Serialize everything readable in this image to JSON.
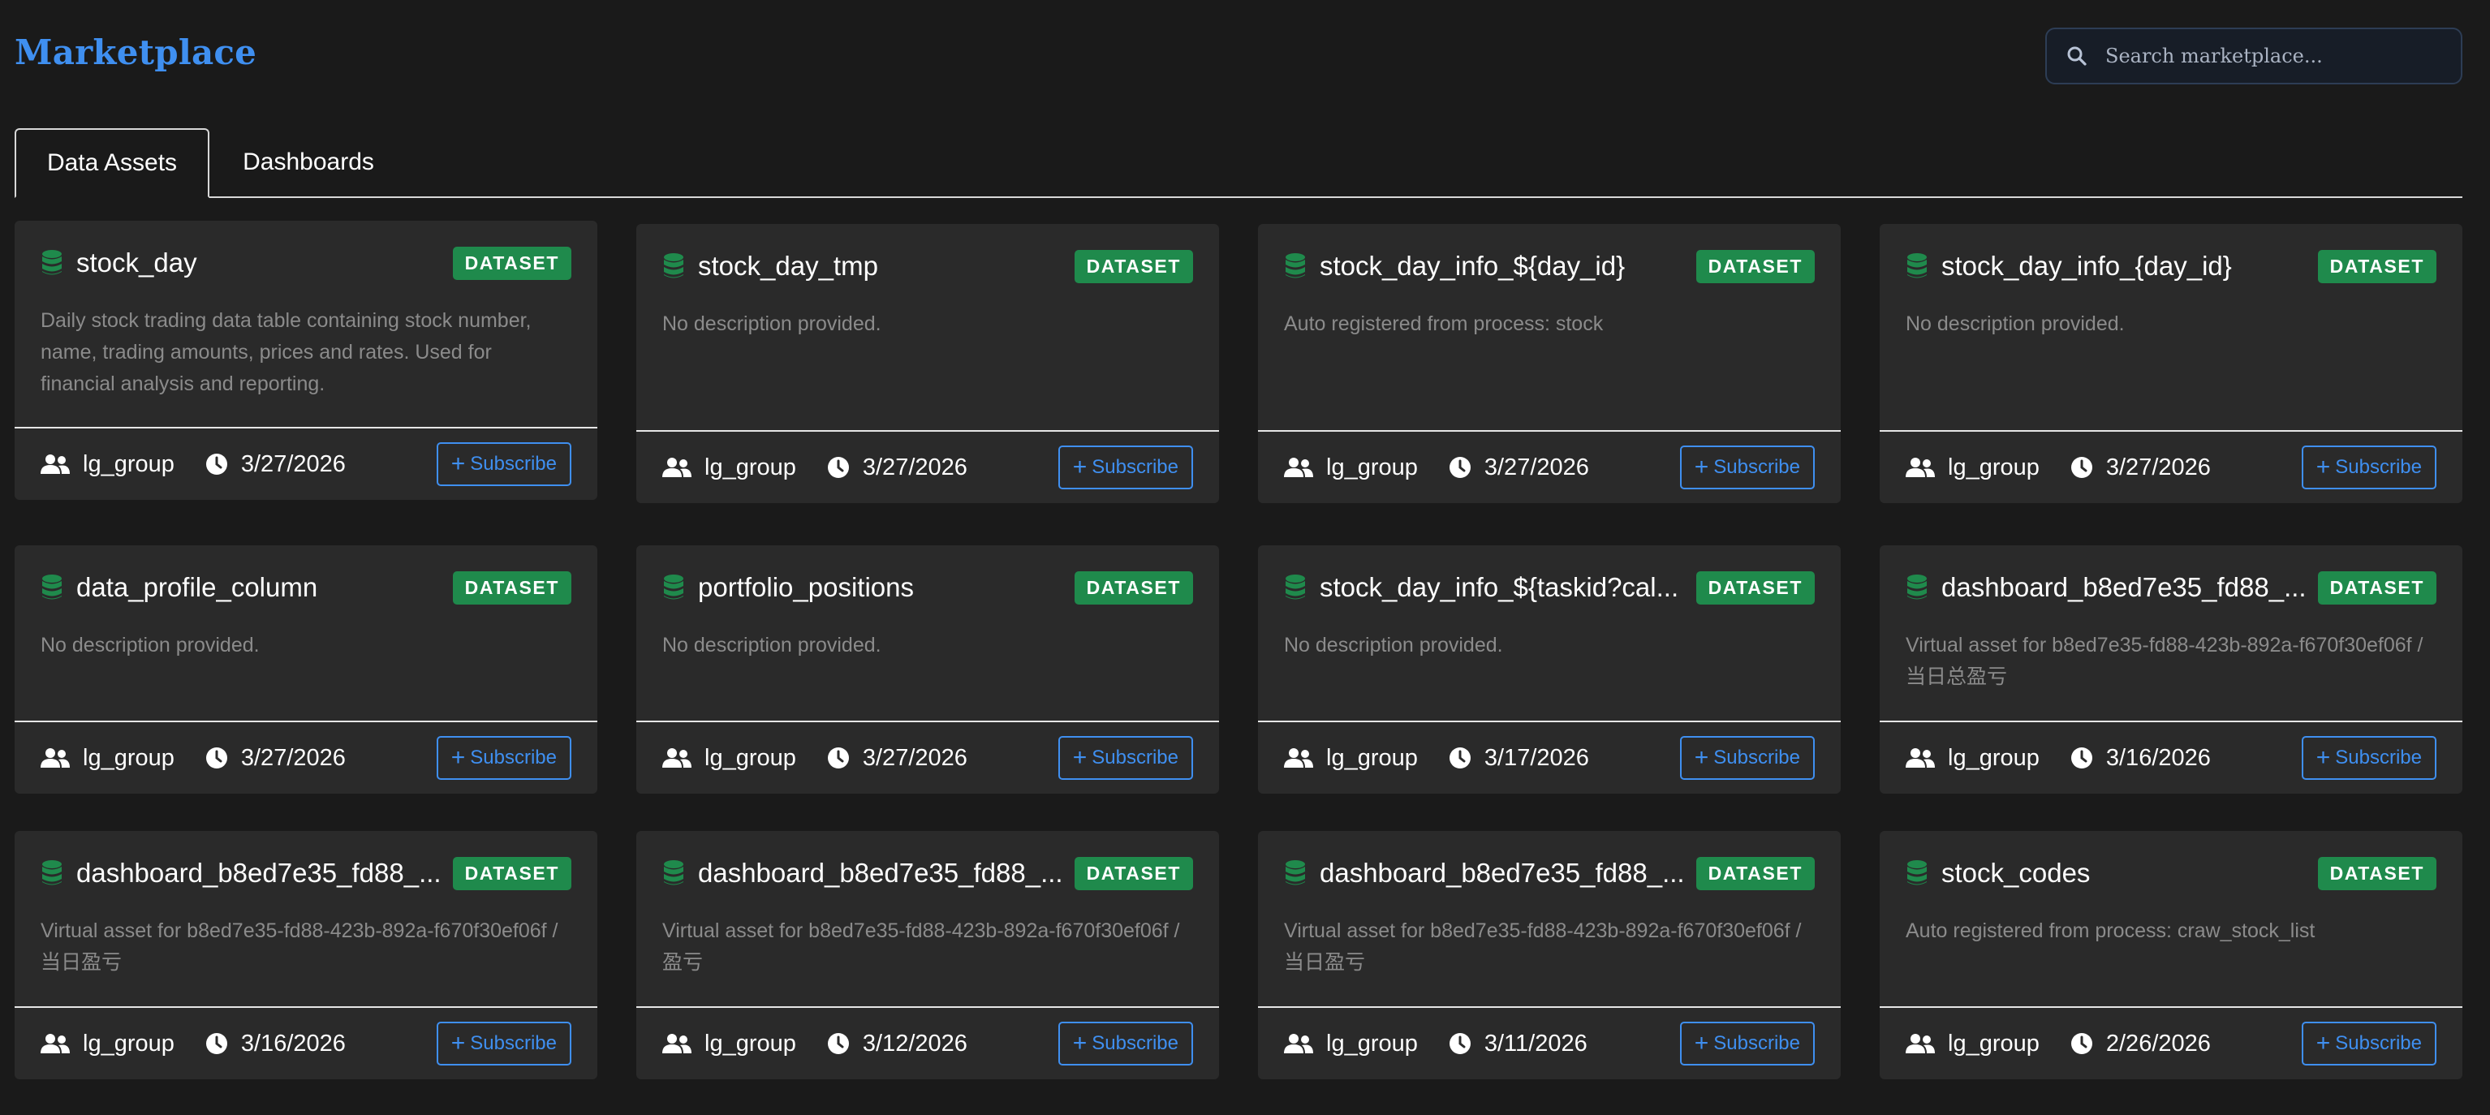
{
  "header": {
    "title": "Marketplace",
    "search_placeholder": "Search marketplace..."
  },
  "tabs": [
    {
      "label": "Data Assets",
      "active": true
    },
    {
      "label": "Dashboards",
      "active": false
    }
  ],
  "colors": {
    "accent": "#3f8ff0",
    "badge": "#1f8a4c",
    "card_bg": "#2a2a2a",
    "page_bg": "#1a1a1a"
  },
  "subscribe_label": "Subscribe",
  "cards": [
    {
      "title": "stock_day",
      "badge": "DATASET",
      "description": "Daily stock trading data table containing stock number, name, trading amounts, prices and rates. Used for financial analysis and reporting.",
      "group": "lg_group",
      "date": "3/27/2026"
    },
    {
      "title": "stock_day_tmp",
      "badge": "DATASET",
      "description": "No description provided.",
      "group": "lg_group",
      "date": "3/27/2026"
    },
    {
      "title": "stock_day_info_${day_id}",
      "badge": "DATASET",
      "description": "Auto registered from process: stock",
      "group": "lg_group",
      "date": "3/27/2026"
    },
    {
      "title": "stock_day_info_{day_id}",
      "badge": "DATASET",
      "description": "No description provided.",
      "group": "lg_group",
      "date": "3/27/2026"
    },
    {
      "title": "data_profile_column",
      "badge": "DATASET",
      "description": "No description provided.",
      "group": "lg_group",
      "date": "3/27/2026"
    },
    {
      "title": "portfolio_positions",
      "badge": "DATASET",
      "description": "No description provided.",
      "group": "lg_group",
      "date": "3/27/2026"
    },
    {
      "title": "stock_day_info_${taskid?cal...",
      "badge": "DATASET",
      "description": "No description provided.",
      "group": "lg_group",
      "date": "3/17/2026"
    },
    {
      "title": "dashboard_b8ed7e35_fd88_...",
      "badge": "DATASET",
      "description": "Virtual asset for b8ed7e35-fd88-423b-892a-f670f30ef06f / 当日总盈亏",
      "group": "lg_group",
      "date": "3/16/2026"
    },
    {
      "title": "dashboard_b8ed7e35_fd88_...",
      "badge": "DATASET",
      "description": "Virtual asset for b8ed7e35-fd88-423b-892a-f670f30ef06f / 当日盈亏",
      "group": "lg_group",
      "date": "3/16/2026"
    },
    {
      "title": "dashboard_b8ed7e35_fd88_...",
      "badge": "DATASET",
      "description": "Virtual asset for b8ed7e35-fd88-423b-892a-f670f30ef06f / 盈亏",
      "group": "lg_group",
      "date": "3/12/2026"
    },
    {
      "title": "dashboard_b8ed7e35_fd88_...",
      "badge": "DATASET",
      "description": "Virtual asset for b8ed7e35-fd88-423b-892a-f670f30ef06f / 当日盈亏",
      "group": "lg_group",
      "date": "3/11/2026"
    },
    {
      "title": "stock_codes",
      "badge": "DATASET",
      "description": "Auto registered from process: craw_stock_list",
      "group": "lg_group",
      "date": "2/26/2026"
    }
  ]
}
